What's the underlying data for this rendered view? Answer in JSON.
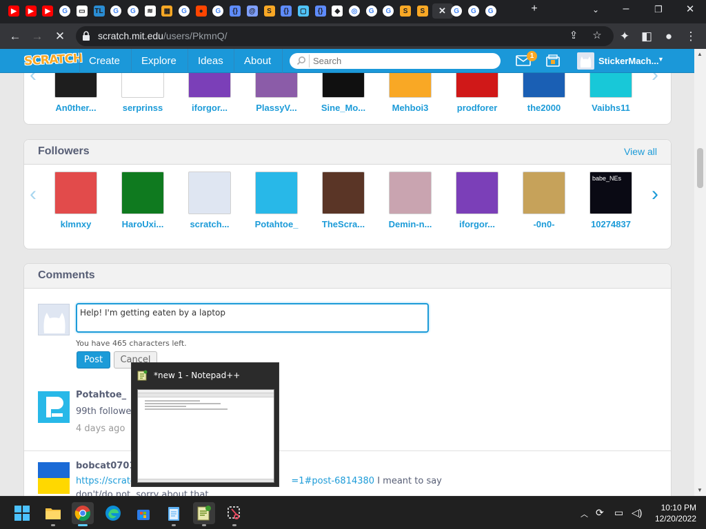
{
  "browser": {
    "url_host": "scratch.mit.edu",
    "url_path": "/users/PkmnQ/",
    "tab_favicons": [
      {
        "name": "youtube",
        "color": "#ff0000",
        "glyph": "▶"
      },
      {
        "name": "youtube",
        "color": "#ff0000",
        "glyph": "▶"
      },
      {
        "name": "youtube",
        "color": "#ff0000",
        "glyph": "▶"
      },
      {
        "name": "google",
        "color": "#ffffff",
        "glyph": "G"
      },
      {
        "name": "monitor",
        "color": "#ffffff",
        "glyph": "▭"
      },
      {
        "name": "tl",
        "color": "#2a8dd4",
        "glyph": "TL"
      },
      {
        "name": "google",
        "color": "#ffffff",
        "glyph": "G"
      },
      {
        "name": "google",
        "color": "#ffffff",
        "glyph": "G"
      },
      {
        "name": "wifi",
        "color": "#ffffff",
        "glyph": "≋"
      },
      {
        "name": "grid",
        "color": "#f9a825",
        "glyph": "▦"
      },
      {
        "name": "google",
        "color": "#ffffff",
        "glyph": "G"
      },
      {
        "name": "reddit",
        "color": "#ff4500",
        "glyph": "●"
      },
      {
        "name": "google",
        "color": "#ffffff",
        "glyph": "G"
      },
      {
        "name": "brackets",
        "color": "#5e8cff",
        "glyph": "{}"
      },
      {
        "name": "at",
        "color": "#7fa0ff",
        "glyph": "@"
      },
      {
        "name": "scratch",
        "color": "#f9a825",
        "glyph": "S"
      },
      {
        "name": "brackets",
        "color": "#5e8cff",
        "glyph": "{}"
      },
      {
        "name": "chat",
        "color": "#4fc3f7",
        "glyph": "▢"
      },
      {
        "name": "brackets",
        "color": "#5e8cff",
        "glyph": "{}"
      },
      {
        "name": "roblox",
        "color": "#ffffff",
        "glyph": "◆"
      },
      {
        "name": "chrome",
        "color": "#ffffff",
        "glyph": "◎"
      },
      {
        "name": "google",
        "color": "#ffffff",
        "glyph": "G"
      },
      {
        "name": "google",
        "color": "#ffffff",
        "glyph": "G"
      },
      {
        "name": "scratch",
        "color": "#f9a825",
        "glyph": "S"
      },
      {
        "name": "scratch",
        "color": "#f9a825",
        "glyph": "S"
      },
      {
        "name": "close",
        "color": "#e8eaed",
        "glyph": "✕"
      },
      {
        "name": "google",
        "color": "#ffffff",
        "glyph": "G"
      },
      {
        "name": "google",
        "color": "#ffffff",
        "glyph": "G"
      },
      {
        "name": "google",
        "color": "#ffffff",
        "glyph": "G"
      }
    ]
  },
  "scratch_nav": {
    "logo": "SCRATCH",
    "links": [
      "Create",
      "Explore",
      "Ideas",
      "About"
    ],
    "search_placeholder": "Search",
    "messages_count": "1",
    "username": "StickerMach..."
  },
  "following_partial": {
    "users": [
      "An0ther...",
      "serprinss",
      "iforgor...",
      "PlassyV...",
      "Sine_Mo...",
      "Mehboi3",
      "prodforer",
      "the2000",
      "Vaibhs11"
    ]
  },
  "followers": {
    "title": "Followers",
    "view_all": "View all",
    "users": [
      {
        "name": "klmnxy",
        "thumb_color": "#e24b4b"
      },
      {
        "name": "HaroUxi...",
        "thumb_color": "#0f7a1f"
      },
      {
        "name": "scratch...",
        "thumb_color": "#dfe6f2"
      },
      {
        "name": "Potahtoe_",
        "thumb_color": "#28b8e8"
      },
      {
        "name": "TheScra...",
        "thumb_color": "#5a3526"
      },
      {
        "name": "Demin-n...",
        "thumb_color": "#c9a4b0"
      },
      {
        "name": "iforgor...",
        "thumb_color": "#7b3fb8"
      },
      {
        "name": "-0n0-",
        "thumb_color": "#c6a25a"
      },
      {
        "name": "10274837",
        "thumb_color": "#0a0a14",
        "thumb_text": "babe_NEs"
      }
    ]
  },
  "comments": {
    "title": "Comments",
    "input_value": "Help! I'm getting eaten by a laptop",
    "chars_left": "You have 465 characters left.",
    "post_label": "Post",
    "cancel_label": "Cancel",
    "items": [
      {
        "author": "Potahtoe_",
        "text": "99th follower",
        "time": "4 days ago"
      },
      {
        "author": "bobcat0701",
        "link": "https://scratch",
        "link_tail": "=1#post-6814380",
        "text_tail": " I meant to say",
        "text2": "don't/do not, sorry about that"
      }
    ]
  },
  "taskbar_preview": {
    "title": "*new 1 - Notepad++"
  },
  "taskbar": {
    "time": "10:10 PM",
    "date": "12/20/2022"
  }
}
